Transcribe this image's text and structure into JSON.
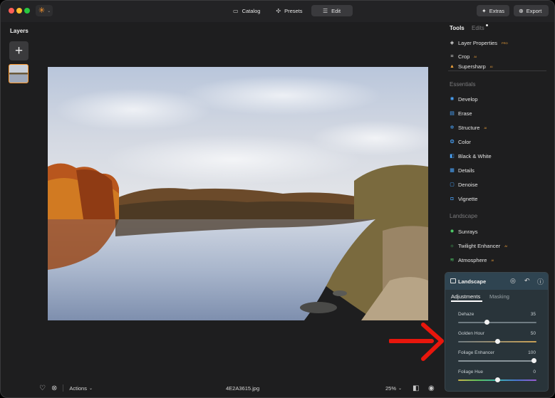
{
  "toolbar": {
    "modes": [
      {
        "label": "Catalog",
        "icon": "catalog-icon"
      },
      {
        "label": "Presets",
        "icon": "presets-icon"
      },
      {
        "label": "Edit",
        "icon": "edit-sliders-icon",
        "active": true
      }
    ],
    "extras_label": "Extras",
    "export_label": "Export"
  },
  "layers": {
    "title": "Layers"
  },
  "right_panel": {
    "tools_tab": "Tools",
    "edits_tab": "Edits",
    "top_tools": [
      {
        "label": "Layer Properties",
        "badge": "PRO"
      },
      {
        "label": "Crop",
        "badge": "AI"
      },
      {
        "label": "Supersharp",
        "badge": "AI"
      }
    ],
    "essentials_title": "Essentials",
    "essentials": [
      {
        "label": "Develop",
        "badge": ""
      },
      {
        "label": "Erase",
        "badge": ""
      },
      {
        "label": "Structure",
        "badge": "AI"
      },
      {
        "label": "Color",
        "badge": ""
      },
      {
        "label": "Black & White",
        "badge": ""
      },
      {
        "label": "Details",
        "badge": ""
      },
      {
        "label": "Denoise",
        "badge": ""
      },
      {
        "label": "Vignette",
        "badge": ""
      }
    ],
    "landscape_title": "Landscape",
    "landscape_tools": [
      {
        "label": "Sunrays",
        "badge": ""
      },
      {
        "label": "Twilight Enhancer",
        "badge": "AI"
      },
      {
        "label": "Atmosphere",
        "badge": "AI"
      }
    ]
  },
  "landscape_panel": {
    "title": "Landscape",
    "tabs": [
      "Adjustments",
      "Masking"
    ],
    "active_tab": "Adjustments",
    "sliders": [
      {
        "label": "Dehaze",
        "value": "35",
        "fraction": 0.35
      },
      {
        "label": "Golden Hour",
        "value": "50",
        "fraction": 0.5
      },
      {
        "label": "Foliage Enhancer",
        "value": "100",
        "fraction": 1.0
      },
      {
        "label": "Foliage Hue",
        "value": "0",
        "fraction": 0.5
      }
    ]
  },
  "bottom_bar": {
    "actions_label": "Actions",
    "filename": "4E2A3615.jpg",
    "zoom": "25%"
  },
  "colors": {
    "accent_orange": "#ff9a2e",
    "arrow_red": "#e8160c",
    "panel_teal": "#2f4451"
  }
}
